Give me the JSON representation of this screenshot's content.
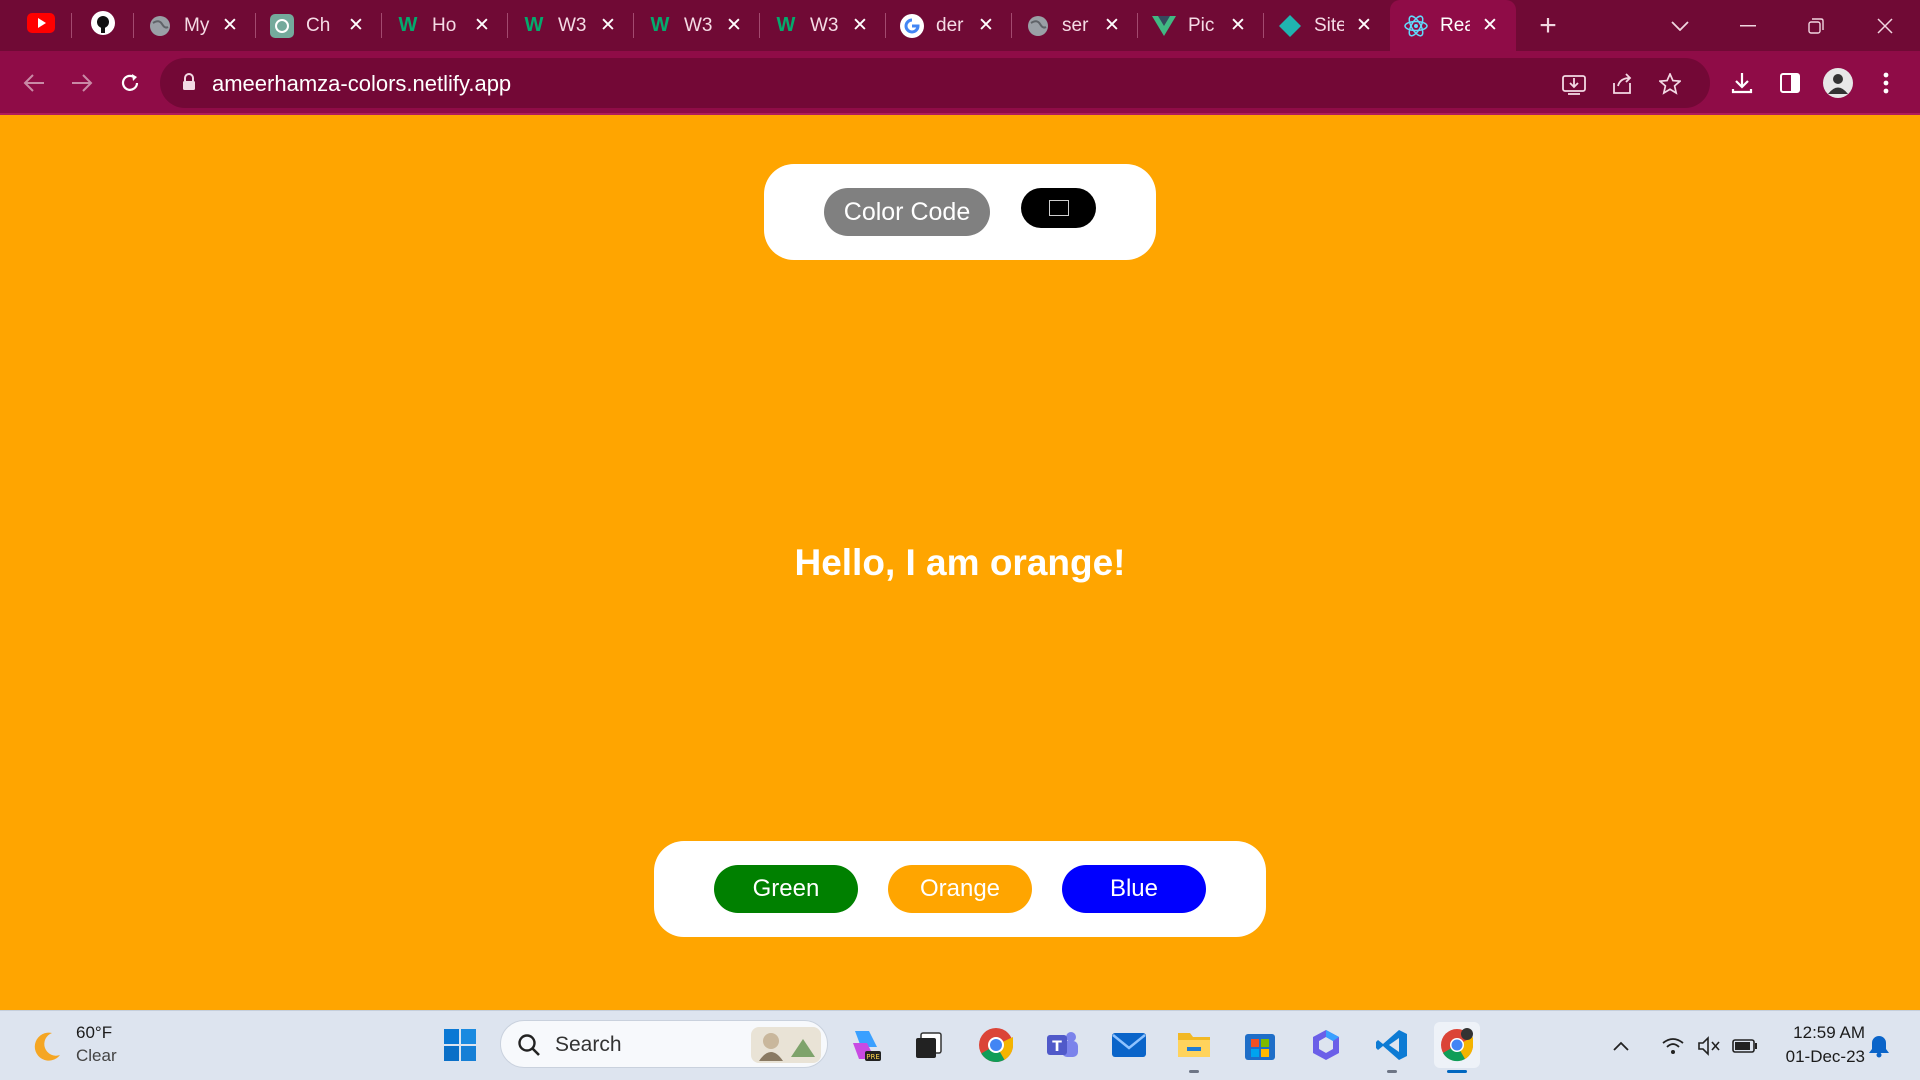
{
  "browser": {
    "tabs": [
      {
        "title": "",
        "icon": "youtube-icon"
      },
      {
        "title": "",
        "icon": "github-icon"
      },
      {
        "title": "My",
        "icon": "globe-icon"
      },
      {
        "title": "Ch",
        "icon": "chatgpt-icon"
      },
      {
        "title": "Ho",
        "icon": "w3schools-icon"
      },
      {
        "title": "W3",
        "icon": "w3schools-icon"
      },
      {
        "title": "W3",
        "icon": "w3schools-icon"
      },
      {
        "title": "W3",
        "icon": "w3schools-icon"
      },
      {
        "title": "der",
        "icon": "google-icon"
      },
      {
        "title": "ser",
        "icon": "globe-icon"
      },
      {
        "title": "Pic",
        "icon": "vue-icon"
      },
      {
        "title": "Site",
        "icon": "netlify-icon"
      },
      {
        "title": "Rea",
        "icon": "react-icon",
        "active": true
      }
    ],
    "url": "ameerhamza-colors.netlify.app",
    "accent_color": "#8f0c47",
    "tabstrip_color": "#700a35"
  },
  "page": {
    "background_color": "#ffa500",
    "color_code_label": "Color Code",
    "color_input_value": "#000000",
    "greeting": "Hello, I am orange!",
    "buttons": [
      {
        "label": "Green",
        "color": "#008000"
      },
      {
        "label": "Orange",
        "color": "#ffa500"
      },
      {
        "label": "Blue",
        "color": "#0000ff"
      }
    ]
  },
  "taskbar": {
    "weather_temp": "60°F",
    "weather_condition": "Clear",
    "search_placeholder": "Search",
    "apps": [
      "copilot-icon",
      "task-view-icon",
      "chrome-icon",
      "teams-icon",
      "mail-icon",
      "file-explorer-icon",
      "store-icon",
      "microsoft365-icon",
      "vscode-icon",
      "chrome-profile-icon"
    ],
    "time": "12:59 AM",
    "date": "01-Dec-23"
  }
}
